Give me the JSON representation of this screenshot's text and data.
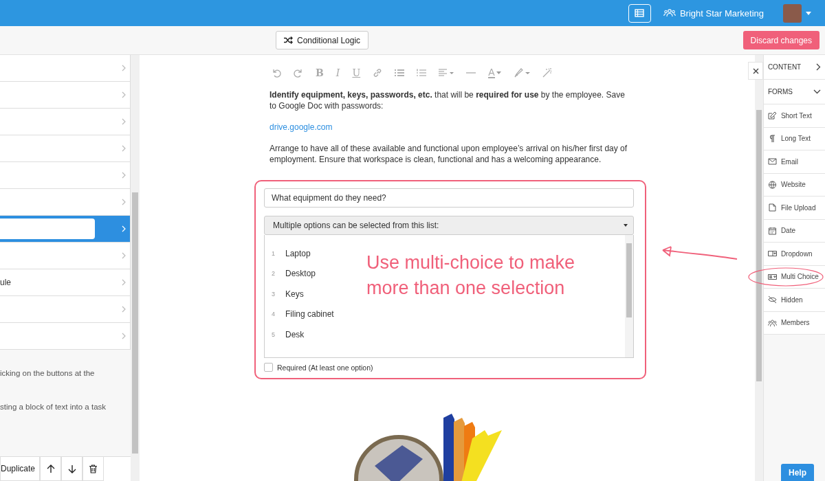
{
  "top_bar": {
    "team_name": "Bright Star Marketing"
  },
  "action_bar": {
    "conditional_logic": "Conditional Logic",
    "discard": "Discard changes"
  },
  "task_list": {
    "rows": [
      {
        "selected": false
      },
      {
        "selected": false
      },
      {
        "selected": false
      },
      {
        "selected": false
      },
      {
        "selected": false
      },
      {
        "selected": false
      },
      {
        "selected": true
      },
      {
        "selected": false
      },
      {
        "label": "ule",
        "selected": false
      },
      {
        "selected": false
      },
      {
        "selected": false
      }
    ],
    "notes": [
      "icking on the buttons at the",
      "sting a block of text into a task"
    ],
    "actions": {
      "duplicate": "Duplicate"
    }
  },
  "editor": {
    "toolbar": {
      "bold": "B",
      "italic": "I",
      "underline": "U",
      "text_color": "A"
    },
    "paragraph_1": "**Identify equipment, keys, passwords, etc.** that will be **required for use** by the employee. Save to Google Doc with passwords:",
    "link": "drive.google.com",
    "paragraph_2": "Arrange to have all of these available and functional upon employee’s arrival on his/her first day of employment. Ensure that workspace is clean, functional and has a welcoming appearance.",
    "form": {
      "question": "What equipment do they need?",
      "select": "Multiple options can be selected from this list:",
      "options": [
        {
          "number": "1",
          "label": "Laptop"
        },
        {
          "number": "2",
          "label": "Desktop"
        },
        {
          "number": "3",
          "label": "Keys"
        },
        {
          "number": "4",
          "label": "Filing cabinet"
        },
        {
          "number": "5",
          "label": "Desk"
        }
      ],
      "required": {
        "label": "Required (At least one option)",
        "checked": false
      }
    }
  },
  "annotation": {
    "text": "Use multi-choice to make more than one selection"
  },
  "side_panel": {
    "sections": [
      {
        "title": "CONTENT",
        "expanded": false
      },
      {
        "title": "FORMS",
        "expanded": true,
        "items": [
          {
            "kind": "short_text",
            "label": "Short Text",
            "highlighted": false
          },
          {
            "kind": "long_text",
            "label": "Long Text",
            "highlighted": false
          },
          {
            "kind": "email",
            "label": "Email",
            "highlighted": false
          },
          {
            "kind": "website",
            "label": "Website",
            "highlighted": false
          },
          {
            "kind": "file_upload",
            "label": "File Upload",
            "highlighted": false
          },
          {
            "kind": "date",
            "label": "Date",
            "highlighted": false
          },
          {
            "kind": "dropdown",
            "label": "Dropdown",
            "highlighted": false
          },
          {
            "kind": "multi_choice",
            "label": "Multi Choice",
            "highlighted": true
          },
          {
            "kind": "hidden",
            "label": "Hidden",
            "highlighted": false
          },
          {
            "kind": "members",
            "label": "Members",
            "highlighted": false
          }
        ]
      }
    ]
  },
  "help": "Help"
}
